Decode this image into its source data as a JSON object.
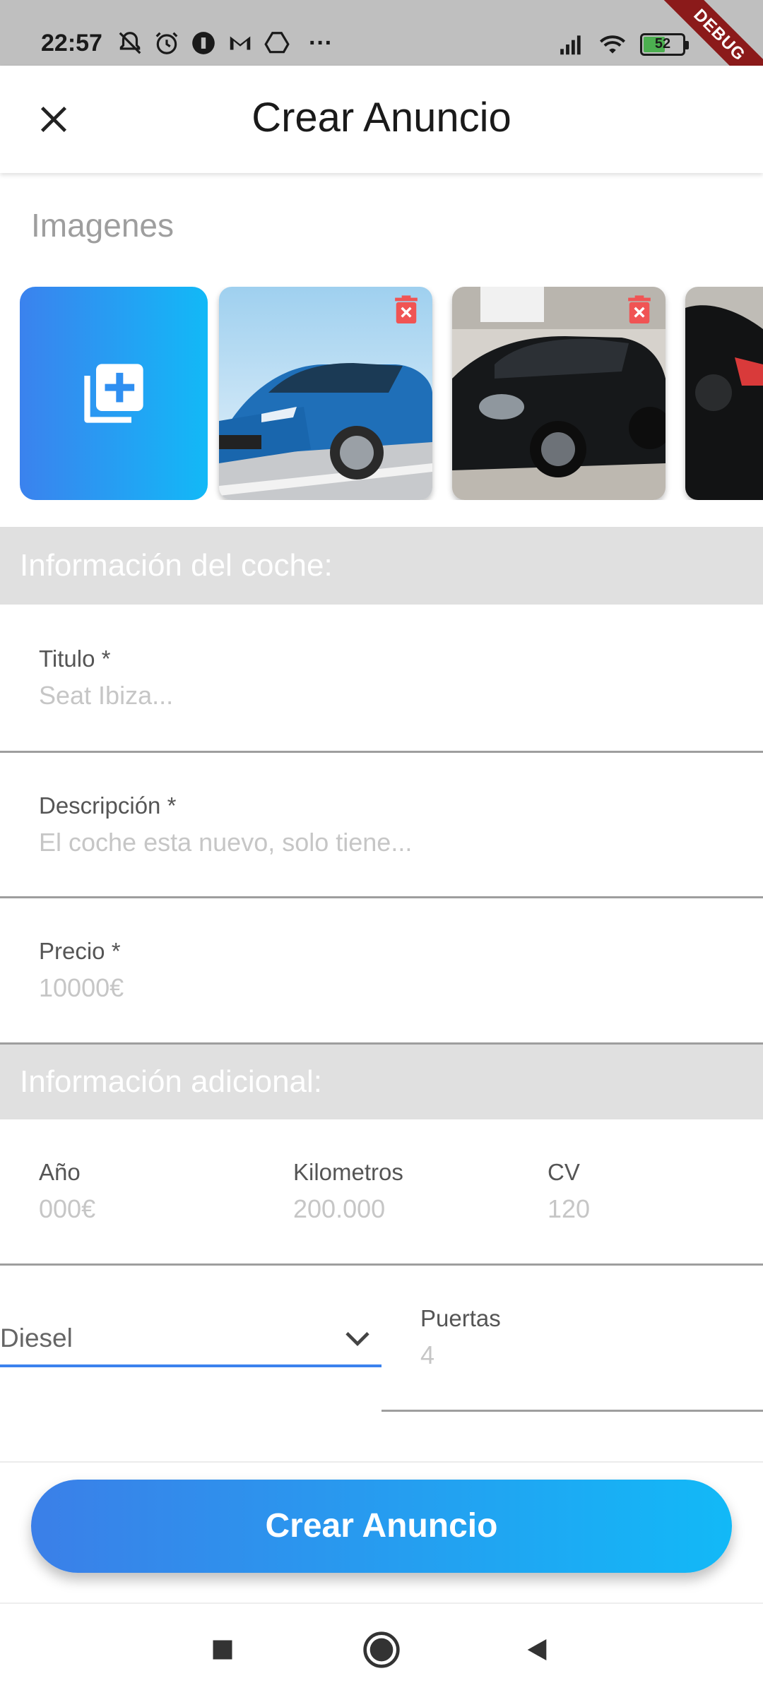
{
  "status_bar": {
    "time": "22:57",
    "more": "···",
    "battery_level": "52",
    "battery_fraction": 0.52,
    "debug_label": "DEBUG"
  },
  "app_bar": {
    "title": "Crear Anuncio",
    "close_icon": "close-icon"
  },
  "images": {
    "section_title": "Imagenes",
    "add_icon": "add-photo-icon",
    "delete_icon": "delete-icon"
  },
  "car_info": {
    "section_title": "Información del coche:",
    "fields": [
      {
        "label": "Titulo *",
        "placeholder": "Seat Ibiza..."
      },
      {
        "label": "Descripción *",
        "placeholder": "El coche esta nuevo, solo tiene..."
      },
      {
        "label": "Precio *",
        "placeholder": "10000€"
      }
    ]
  },
  "additional_info": {
    "section_title": "Información adicional:",
    "fields": [
      {
        "label": "Año",
        "placeholder": "000€"
      },
      {
        "label": "Kilometros",
        "placeholder": "200.000"
      },
      {
        "label": "CV",
        "placeholder": "120"
      }
    ],
    "fuel_select": {
      "value": "Diesel"
    },
    "doors": {
      "label": "Puertas",
      "placeholder": "4"
    }
  },
  "submit_button": {
    "label": "Crear Anuncio"
  },
  "colors": {
    "accent_start": "#3b82ee",
    "accent_end": "#12b9f7",
    "section_header_bg": "#e0e0e0",
    "delete_red": "#f05454",
    "debug_ribbon": "#8b1a1a"
  },
  "nav": {
    "recents_icon": "square-icon",
    "home_icon": "circle-icon",
    "back_icon": "back-triangle-icon"
  }
}
